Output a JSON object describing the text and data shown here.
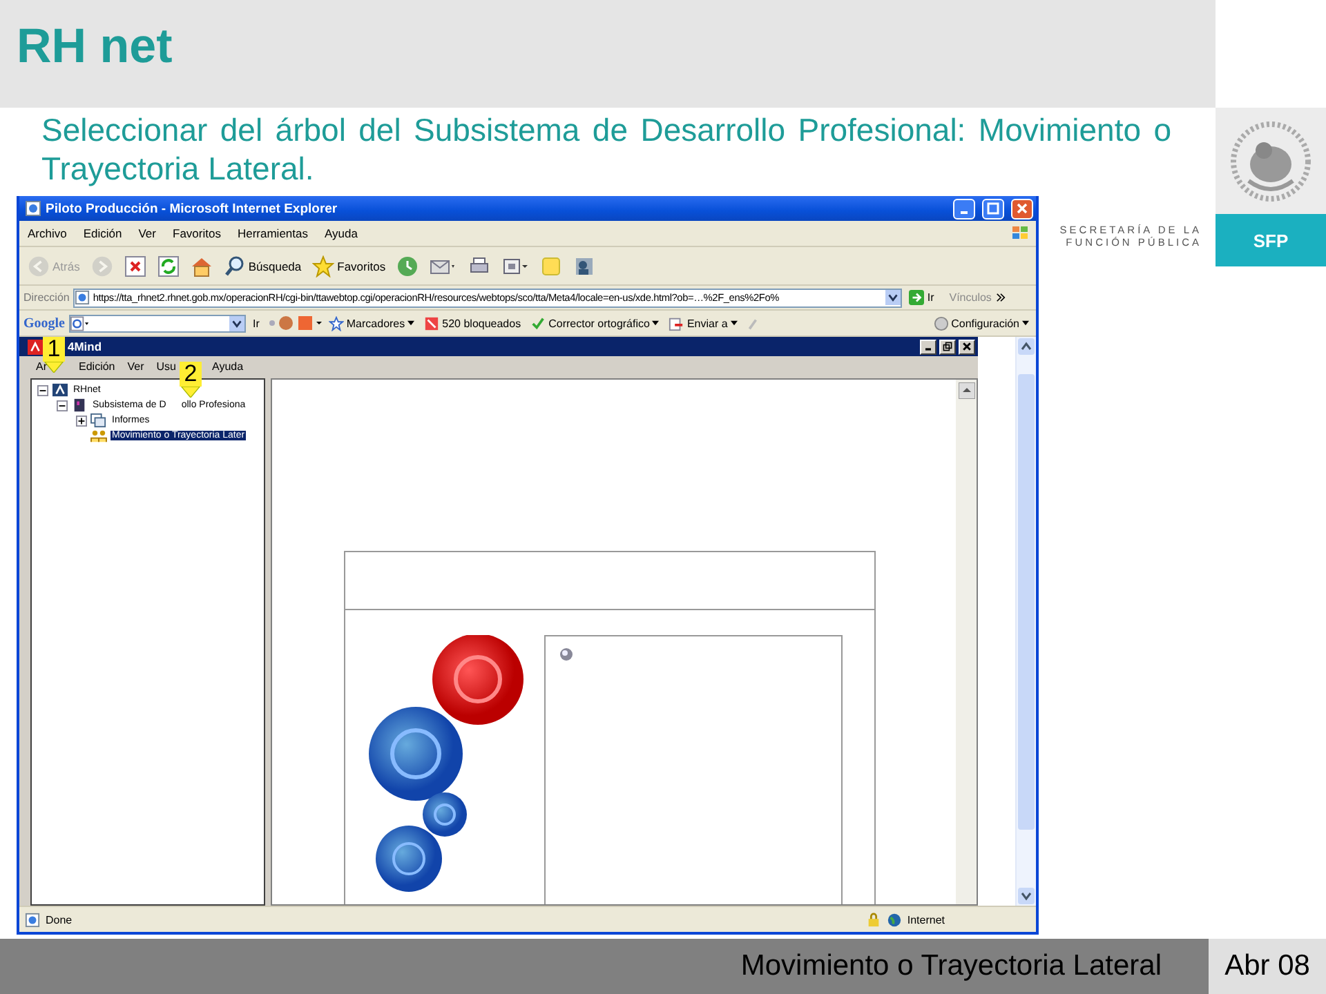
{
  "header": {
    "title": "RH net"
  },
  "instruction": "Seleccionar del árbol del Subsistema de Desarrollo Profesional: Movimiento o Trayectoria Lateral.",
  "agency": {
    "lines": [
      "SECRETARÍA DE LA",
      "FUNCIÓN PÚBLICA"
    ],
    "badge": "SFP"
  },
  "browser": {
    "title": "Piloto Producción - Microsoft Internet Explorer",
    "menu": [
      "Archivo",
      "Edición",
      "Ver",
      "Favoritos",
      "Herramientas",
      "Ayuda"
    ],
    "toolbar": [
      {
        "kind": "back",
        "label": "Atrás",
        "disabled": true
      },
      {
        "kind": "forward",
        "disabled": true
      },
      {
        "kind": "stop",
        "disabled": false
      },
      {
        "kind": "refresh",
        "disabled": false
      },
      {
        "kind": "home",
        "disabled": false
      },
      {
        "kind": "search",
        "label": "Búsqueda",
        "disabled": false
      },
      {
        "kind": "favorites",
        "label": "Favoritos",
        "disabled": false
      },
      {
        "kind": "history",
        "disabled": false
      },
      {
        "kind": "mail",
        "disabled": false
      },
      {
        "kind": "print",
        "disabled": false
      },
      {
        "kind": "edit",
        "disabled": false
      },
      {
        "kind": "folder",
        "disabled": false
      },
      {
        "kind": "messenger",
        "disabled": false
      }
    ],
    "address": {
      "label": "Dirección",
      "url": "https://tta_rhnet2.rhnet.gob.mx/operacionRH/cgi-bin/ttawebtop.cgi/operacionRH/resources/webtops/sco/tta/Meta4/locale=en-us/xde.html?ob=…%2F_ens%2Fo%",
      "go": "Ir",
      "links": "Vínculos"
    },
    "google_bar": {
      "logo": "Google",
      "go": "Ir",
      "items": [
        "Marcadores",
        "520 bloqueados",
        "Corrector ortográfico",
        "Enviar a"
      ],
      "settings": "Configuración"
    },
    "status": {
      "text": "Done",
      "zone": "Internet"
    }
  },
  "app": {
    "title": "4Mind",
    "menu": [
      "Ar",
      "Edición",
      "Ver",
      "Usu",
      "Ayuda"
    ],
    "markers": [
      "1",
      "2"
    ],
    "tree": [
      {
        "kind": "root",
        "label": "RHnet",
        "expanded": true,
        "selected": false,
        "children": [
          {
            "kind": "subsystem",
            "label": "Subsistema de D",
            "label_after_marker": "ollo Profesiona",
            "expanded": true,
            "selected": false,
            "children": [
              {
                "kind": "folder",
                "label": "Informes",
                "expanded": false,
                "selected": false
              },
              {
                "kind": "people",
                "label": "Movimiento o Trayectoria Later",
                "selected": true
              }
            ]
          }
        ]
      }
    ]
  },
  "footer": {
    "title": "Movimiento o Trayectoria Lateral",
    "date": "Abr 08"
  }
}
